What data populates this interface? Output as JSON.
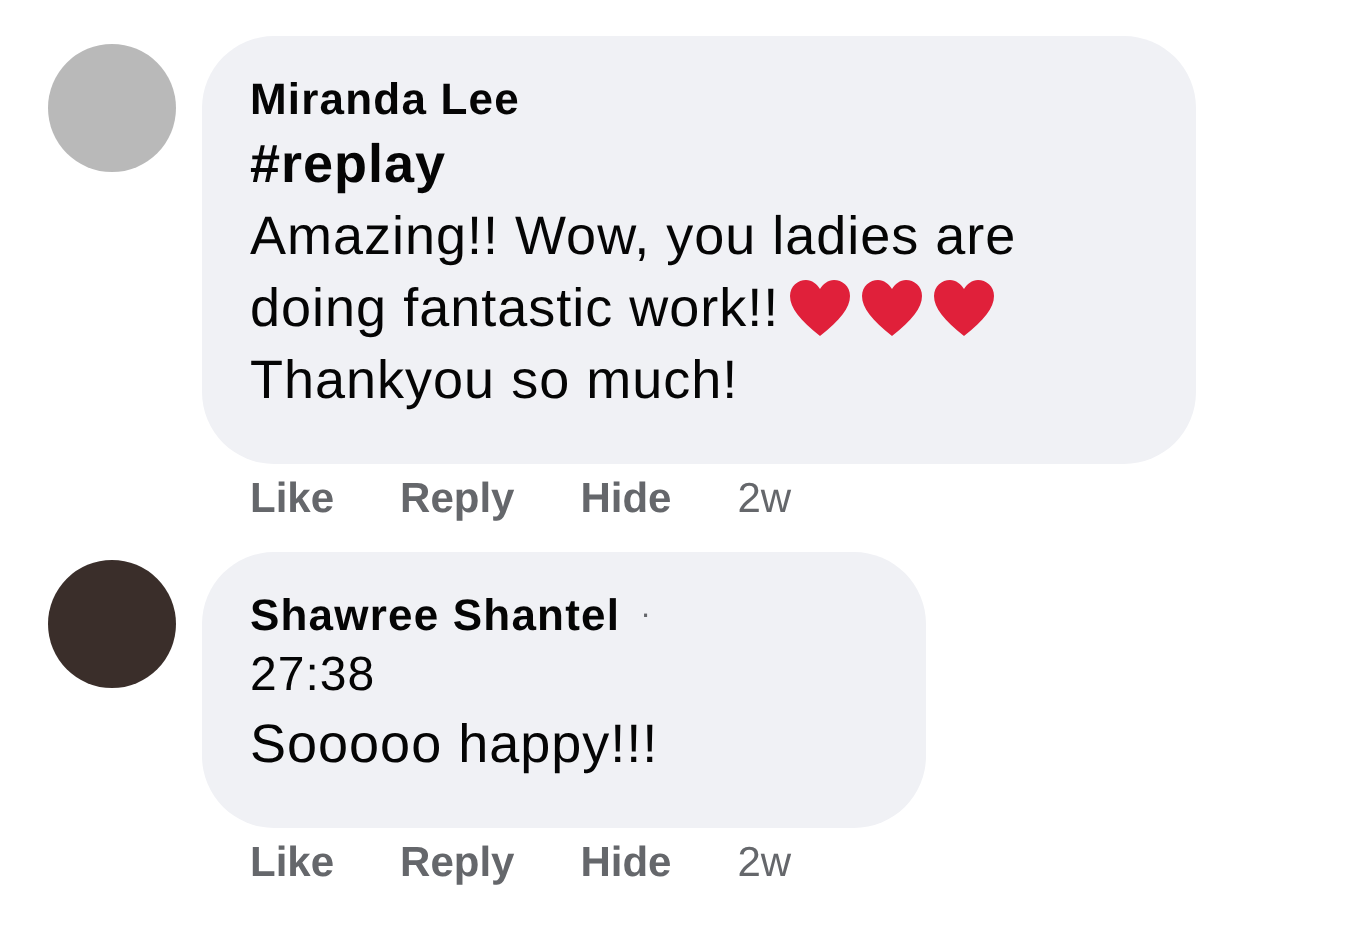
{
  "comments": [
    {
      "author": "Miranda Lee",
      "lines": [
        {
          "text": "#replay",
          "kind": "hashtag"
        },
        {
          "text": "Amazing!! Wow, you ladies are",
          "kind": "plain"
        },
        {
          "text": "doing fantastic work!!",
          "kind": "plain",
          "emoji": [
            {
              "kind": "heart"
            },
            {
              "kind": "heart"
            },
            {
              "kind": "heart"
            }
          ]
        },
        {
          "text": "Thankyou so much!",
          "kind": "plain"
        }
      ],
      "actions": [
        "Like",
        "Reply",
        "Hide"
      ],
      "age": "2w"
    },
    {
      "author": "Shawree Shantel",
      "separator": "·",
      "lines": [
        {
          "text": "27:38",
          "kind": "timestamp"
        },
        {
          "text": "Sooooo happy!!!",
          "kind": "plain"
        }
      ],
      "actions": [
        "Like",
        "Reply",
        "Hide"
      ],
      "age": "2w"
    }
  ]
}
